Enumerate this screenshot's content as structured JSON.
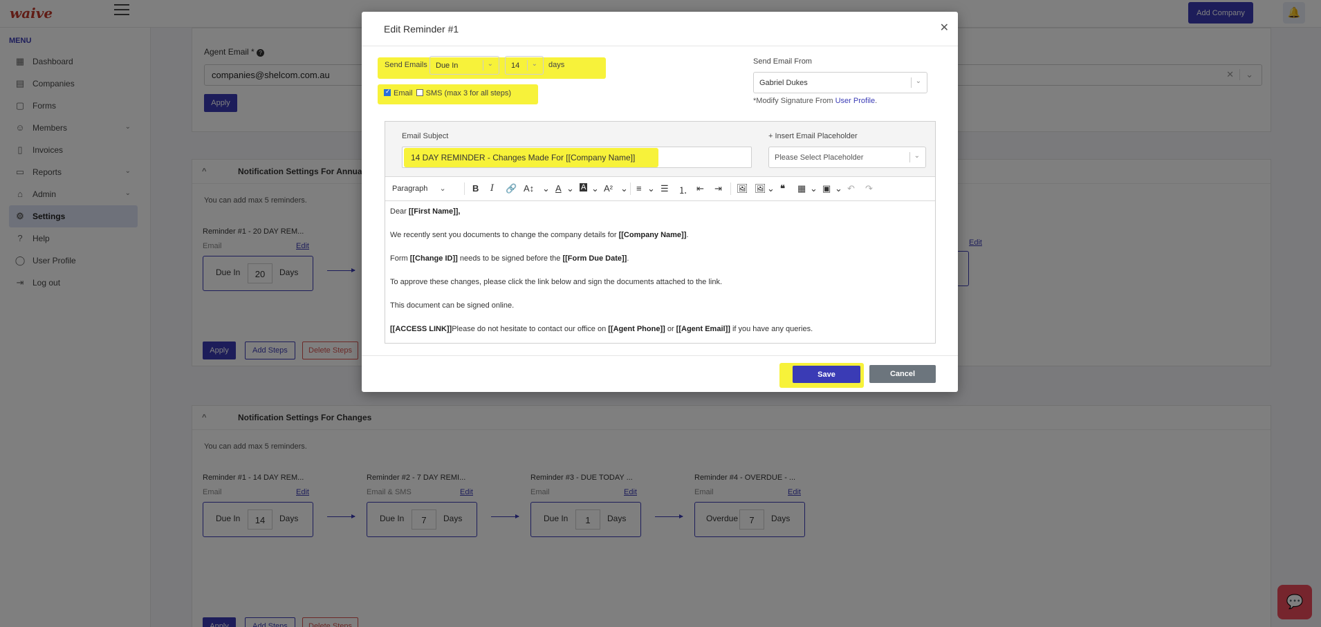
{
  "app": {
    "logo": "waive",
    "add_company": "Add Company"
  },
  "sidebar": {
    "menu_title": "MENU",
    "items": [
      {
        "label": "Dashboard"
      },
      {
        "label": "Companies"
      },
      {
        "label": "Forms"
      },
      {
        "label": "Members"
      },
      {
        "label": "Invoices"
      },
      {
        "label": "Reports"
      },
      {
        "label": "Admin"
      },
      {
        "label": "Settings"
      },
      {
        "label": "Help"
      },
      {
        "label": "User Profile"
      },
      {
        "label": "Log out"
      }
    ]
  },
  "agent_section": {
    "label": "Agent Email *",
    "value": "companies@shelcom.com.au",
    "apply": "Apply"
  },
  "annual_section": {
    "title": "Notification Settings For Annual Revie",
    "hint": "You can add max 5 reminders.",
    "reminder": {
      "title": "Reminder #1 - 20 DAY REM...",
      "type": "Email",
      "edit": "Edit",
      "prefix": "Due In",
      "num": "20",
      "suffix": "Days"
    },
    "right_edit": "Edit",
    "apply": "Apply",
    "add_steps": "Add Steps",
    "delete_steps": "Delete Steps"
  },
  "changes_section": {
    "title": "Notification Settings For Changes",
    "hint": "You can add max 5 reminders.",
    "reminders": [
      {
        "title": "Reminder #1 - 14 DAY REM...",
        "type": "Email",
        "edit": "Edit",
        "prefix": "Due In",
        "num": "14",
        "suffix": "Days"
      },
      {
        "title": "Reminder #2 - 7 DAY REMI...",
        "type": "Email & SMS",
        "edit": "Edit",
        "prefix": "Due In",
        "num": "7",
        "suffix": "Days"
      },
      {
        "title": "Reminder #3 - DUE TODAY ...",
        "type": "Email",
        "edit": "Edit",
        "prefix": "Due In",
        "num": "1",
        "suffix": "Days"
      },
      {
        "title": "Reminder #4 - OVERDUE - ...",
        "type": "Email",
        "edit": "Edit",
        "prefix": "Overdue",
        "num": "7",
        "suffix": "Days"
      }
    ],
    "apply": "Apply",
    "add_steps": "Add Steps",
    "delete_steps": "Delete Steps"
  },
  "modal": {
    "title": "Edit Reminder #1",
    "send_emails_label": "Send Emails",
    "timing_select": "Due In",
    "days_select": "14",
    "days_label": "days",
    "email_checkbox_label": "Email",
    "sms_checkbox_label": "SMS (max 3 for all steps)",
    "send_from_label": "Send Email From",
    "send_from_value": "Gabriel Dukes",
    "modify_signature_prefix": "*Modify Signature From",
    "modify_signature_link": "User Profile",
    "modify_signature_suffix": ".",
    "subject_label": "Email Subject",
    "subject_value": "14 DAY REMINDER -  Changes Made For [[Company Name]]",
    "placeholder_label": "+ Insert Email Placeholder",
    "placeholder_select": "Please Select Placeholder",
    "toolbar": {
      "paragraph": "Paragraph"
    },
    "body": {
      "p1_a": "Dear ",
      "p1_b": "[[First Name]],",
      "p2_a": "We recently sent you documents to change the company details for ",
      "p2_b": "[[Company Name]]",
      "p2_c": ".",
      "p3_a": "Form ",
      "p3_b": "[[Change ID]]",
      "p3_c": " needs to be signed before the ",
      "p3_d": "[[Form Due Date]]",
      "p3_e": ".",
      "p4": "To approve these changes, please click the link below and sign the documents attached to the link.",
      "p5": "This document can be signed online.",
      "p6_a": "[[ACCESS LINK]]",
      "p6_b": "Please do not hesitate to contact our office on ",
      "p6_c": "[[Agent Phone]]",
      "p6_d": " or ",
      "p6_e": "[[Agent Email]]",
      "p6_f": " if you have any queries."
    },
    "save": "Save",
    "cancel": "Cancel"
  },
  "colors": {
    "primary": "#3a3bb5",
    "highlight": "#f7f23a",
    "danger": "#d9534f",
    "chat": "#ec4a5a"
  }
}
